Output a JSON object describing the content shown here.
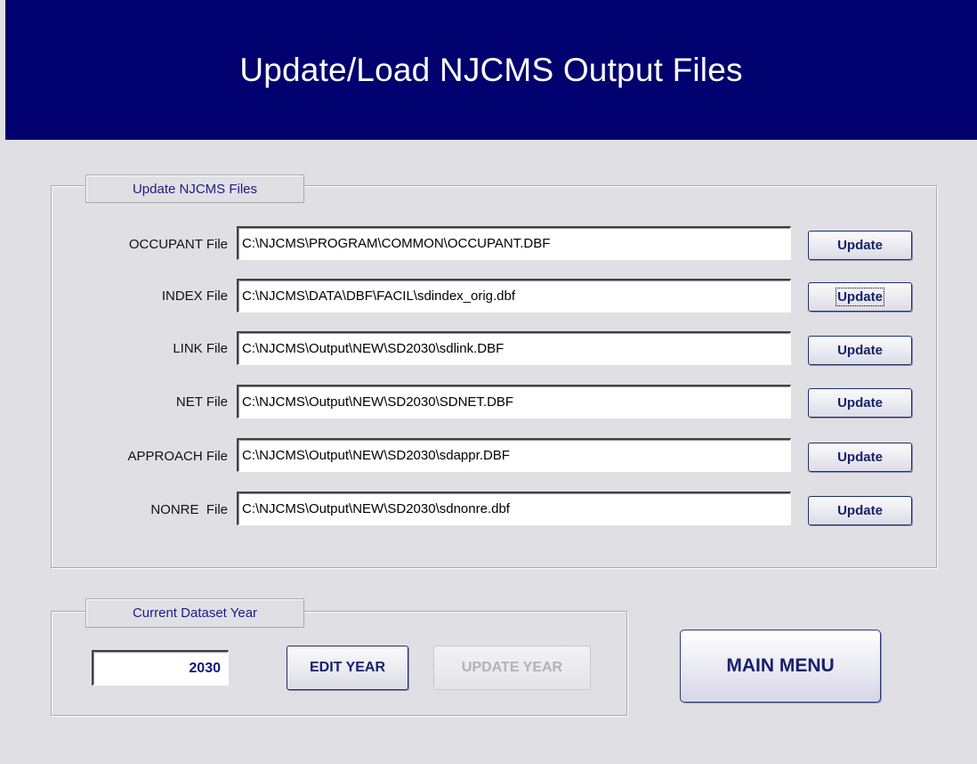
{
  "header": {
    "title": "Update/Load NJCMS Output Files"
  },
  "files_group": {
    "legend": "Update NJCMS Files",
    "rows": [
      {
        "label": "OCCUPANT File",
        "path": "C:\\NJCMS\\PROGRAM\\COMMON\\OCCUPANT.DBF",
        "button": "Update"
      },
      {
        "label": "INDEX File",
        "path": "C:\\NJCMS\\DATA\\DBF\\FACIL\\sdindex_orig.dbf",
        "button": "Update"
      },
      {
        "label": "LINK File",
        "path": "C:\\NJCMS\\Output\\NEW\\SD2030\\sdlink.DBF",
        "button": "Update"
      },
      {
        "label": "NET File",
        "path": "C:\\NJCMS\\Output\\NEW\\SD2030\\SDNET.DBF",
        "button": "Update"
      },
      {
        "label": "APPROACH File",
        "path": "C:\\NJCMS\\Output\\NEW\\SD2030\\sdappr.DBF",
        "button": "Update"
      },
      {
        "label": "NONRE  File",
        "path": "C:\\NJCMS\\Output\\NEW\\SD2030\\sdnonre.dbf",
        "button": "Update"
      }
    ]
  },
  "year_group": {
    "legend": "Current Dataset Year",
    "year_value": "2030",
    "edit_button": "EDIT YEAR",
    "update_button": "UPDATE YEAR"
  },
  "main_menu_button": "MAIN MENU",
  "colors": {
    "header_bg": "#00006e",
    "window_bg": "#e0dfe3",
    "button_text": "#18206a",
    "legend_text": "#1b1b8c"
  }
}
